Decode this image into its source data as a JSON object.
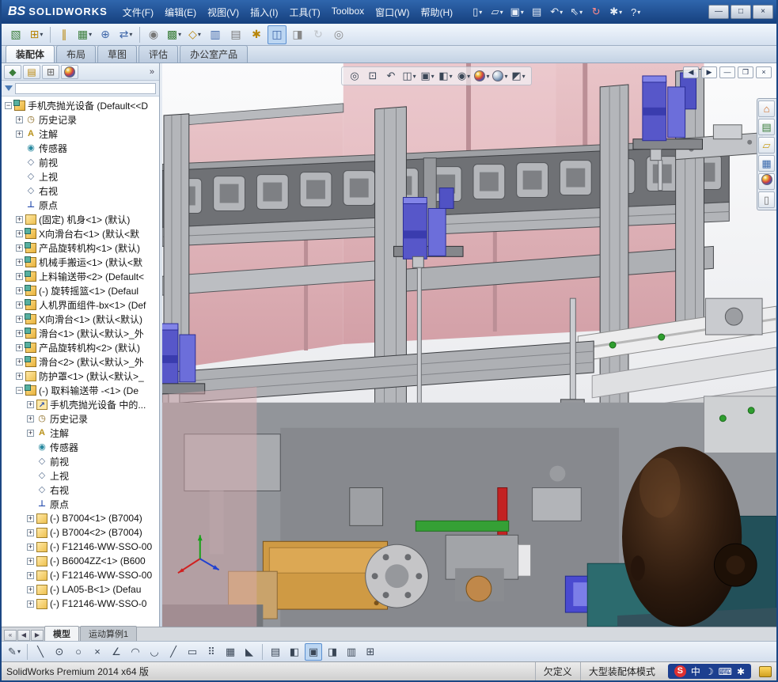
{
  "palette": {
    "titlebar-blue-1": "#2f66ad",
    "titlebar-blue-2": "#16407e",
    "toolbar-bg-1": "#f2f7fd",
    "toolbar-bg-2": "#d4e0ef",
    "panel-bg": "#e9eef6",
    "tree-bg": "#ffffff",
    "pink-panel": "#dcaab0",
    "pink-panel-light": "#e9c2c6",
    "frame-gray": "#b9bbbf",
    "frame-dark": "#4a4a4a",
    "chain-gray": "#9fa1a5",
    "cylinder-purple": "#5757c9",
    "cylinder-purple-dark": "#34349e",
    "gripper-pink": "#e2a2ac",
    "head-brown": "#3a2315",
    "head-dark": "#140b05",
    "orange-part": "#cf9a44",
    "red-part": "#c32222",
    "green-part": "#35a035",
    "teal-frame": "#2c6b6e",
    "blue-clamp": "#4a4ad0",
    "status-bg-1": "#ececec",
    "status-bg-2": "#cfcfcf",
    "ime-blue": "#1d3f8f",
    "sogou-red": "#e03030",
    "active-tool-bg": "#bcd6f2",
    "active-tool-border": "#5a8fd0"
  },
  "titlebar": {
    "logo_mark": "ΒS",
    "logo_text": "SOLIDWORKS",
    "menus": [
      "文件(F)",
      "编辑(E)",
      "视图(V)",
      "插入(I)",
      "工具(T)",
      "Toolbox",
      "窗口(W)",
      "帮助(H)"
    ],
    "quick_icons": [
      {
        "name": "new-document",
        "glyph": "▯",
        "dropdown": true
      },
      {
        "name": "open-document",
        "glyph": "▱",
        "dropdown": true
      },
      {
        "name": "save-document",
        "glyph": "▣",
        "dropdown": true
      },
      {
        "name": "print-document",
        "glyph": "▤"
      },
      {
        "name": "undo",
        "glyph": "↶",
        "dropdown": true
      },
      {
        "name": "select",
        "glyph": "⇖",
        "dropdown": true
      },
      {
        "name": "rebuild",
        "glyph": "↻",
        "color": "#ff8a8a"
      },
      {
        "name": "options",
        "glyph": "✱",
        "dropdown": true
      },
      {
        "name": "help",
        "glyph": "?",
        "dropdown": true
      }
    ],
    "window_buttons": [
      {
        "name": "minimize",
        "glyph": "—"
      },
      {
        "name": "maximize",
        "glyph": "□"
      },
      {
        "name": "close",
        "glyph": "×"
      }
    ]
  },
  "toolbar": {
    "icons": [
      {
        "name": "edit-component",
        "glyph": "▧",
        "color": "#3a7d3a"
      },
      {
        "name": "insert-components",
        "glyph": "⊞",
        "color": "#b8860b",
        "dropdown": true
      },
      {
        "sep": true
      },
      {
        "name": "mate",
        "glyph": "∥",
        "color": "#b8860b"
      },
      {
        "name": "component-pattern",
        "glyph": "▦",
        "color": "#3a7d3a",
        "dropdown": true
      },
      {
        "name": "smart-fasteners",
        "glyph": "⊕",
        "color": "#4169aa"
      },
      {
        "name": "move-component",
        "glyph": "⇄",
        "color": "#4169aa",
        "dropdown": true
      },
      {
        "sep": true
      },
      {
        "name": "show-hidden-components",
        "glyph": "◉",
        "color": "#777777"
      },
      {
        "name": "assembly-features",
        "glyph": "▩",
        "color": "#3a7d3a",
        "dropdown": true
      },
      {
        "name": "reference-geometry",
        "glyph": "◇",
        "color": "#b8860b",
        "dropdown": true
      },
      {
        "name": "new-motion-study",
        "glyph": "▥",
        "color": "#4169aa"
      },
      {
        "name": "bill-of-materials",
        "glyph": "▤",
        "color": "#777777"
      },
      {
        "name": "exploded-view",
        "glyph": "✱",
        "color": "#b8860b"
      },
      {
        "name": "instant3d",
        "glyph": "◫",
        "color": "#4169aa",
        "active": true
      },
      {
        "name": "section-view",
        "glyph": "◨",
        "color": "#888888"
      },
      {
        "name": "simulation",
        "glyph": "↻",
        "color": "#888888",
        "disabled": true
      },
      {
        "name": "isolate",
        "glyph": "◎",
        "color": "#888888"
      }
    ]
  },
  "command_tabs": {
    "items": [
      "装配体",
      "布局",
      "草图",
      "评估",
      "办公室产品"
    ],
    "active_index": 0
  },
  "panel": {
    "tab_icons": [
      {
        "name": "featuremanager-tab",
        "glyph": "◆",
        "color": "#3a7d3a"
      },
      {
        "name": "propertymanager-tab",
        "glyph": "▤",
        "color": "#b8860b"
      },
      {
        "name": "configurationmanager-tab",
        "glyph": "⊞",
        "color": "#777777"
      },
      {
        "name": "displaymanager-tab",
        "glyph": "sphere"
      }
    ],
    "overflow": "»",
    "filter_value": ""
  },
  "tree": {
    "rows": [
      {
        "label": "手机壳抛光设备 (Default<<D",
        "icon": "assembly",
        "level": 0,
        "expand": "minus"
      },
      {
        "label": "历史记录",
        "icon": "history",
        "level": 1,
        "expand": "plus"
      },
      {
        "label": "注解",
        "icon": "annotations",
        "level": 1,
        "expand": "plus"
      },
      {
        "label": "传感器",
        "icon": "sensors",
        "level": 1,
        "expand": null
      },
      {
        "label": "前视",
        "icon": "plane",
        "level": 1,
        "expand": null
      },
      {
        "label": "上视",
        "icon": "plane",
        "level": 1,
        "expand": null
      },
      {
        "label": "右视",
        "icon": "plane",
        "level": 1,
        "expand": null
      },
      {
        "label": "原点",
        "icon": "origin",
        "level": 1,
        "expand": null
      },
      {
        "label": "(固定) 机身<1> (默认)",
        "icon": "part",
        "level": 1,
        "expand": "plus"
      },
      {
        "label": "X向滑台右<1> (默认<默",
        "icon": "assembly",
        "level": 1,
        "expand": "plus"
      },
      {
        "label": "产品旋转机构<1> (默认)",
        "icon": "assembly",
        "level": 1,
        "expand": "plus"
      },
      {
        "label": "机械手搬运<1> (默认<默",
        "icon": "assembly",
        "level": 1,
        "expand": "plus"
      },
      {
        "label": "上料输送带<2> (Default<",
        "icon": "assembly",
        "level": 1,
        "expand": "plus"
      },
      {
        "label": "(-) 旋转摇篮<1> (Defaul",
        "icon": "assembly",
        "level": 1,
        "expand": "plus"
      },
      {
        "label": "人机界面组件-bx<1> (Def",
        "icon": "assembly",
        "level": 1,
        "expand": "plus"
      },
      {
        "label": "X向滑台<1> (默认<默认)",
        "icon": "assembly",
        "level": 1,
        "expand": "plus"
      },
      {
        "label": "滑台<1> (默认<默认>_外",
        "icon": "assembly",
        "level": 1,
        "expand": "plus"
      },
      {
        "label": "产品旋转机构<2> (默认)",
        "icon": "assembly",
        "level": 1,
        "expand": "plus"
      },
      {
        "label": "滑台<2> (默认<默认>_外",
        "icon": "assembly",
        "level": 1,
        "expand": "plus"
      },
      {
        "label": "防护罩<1> (默认<默认>_",
        "icon": "part",
        "level": 1,
        "expand": "plus"
      },
      {
        "label": "(-) 取料输送带 -<1> (De",
        "icon": "assembly",
        "level": 1,
        "expand": "minus"
      },
      {
        "label": "手机壳抛光设备 中的...",
        "icon": "incontext",
        "level": 2,
        "expand": "plus"
      },
      {
        "label": "历史记录",
        "icon": "history",
        "level": 2,
        "expand": "plus"
      },
      {
        "label": "注解",
        "icon": "annotations",
        "level": 2,
        "expand": "plus"
      },
      {
        "label": "传感器",
        "icon": "sensors",
        "level": 2,
        "expand": null
      },
      {
        "label": "前视",
        "icon": "plane",
        "level": 2,
        "expand": null
      },
      {
        "label": "上视",
        "icon": "plane",
        "level": 2,
        "expand": null
      },
      {
        "label": "右视",
        "icon": "plane",
        "level": 2,
        "expand": null
      },
      {
        "label": "原点",
        "icon": "origin",
        "level": 2,
        "expand": null
      },
      {
        "label": "(-) B7004<1> (B7004)",
        "icon": "part",
        "level": 2,
        "expand": "plus"
      },
      {
        "label": "(-) B7004<2> (B7004)",
        "icon": "part",
        "level": 2,
        "expand": "plus"
      },
      {
        "label": "(-) F12146-WW-SSO-00",
        "icon": "part",
        "level": 2,
        "expand": "plus"
      },
      {
        "label": "(-) B6004ZZ<1> (B600",
        "icon": "part",
        "level": 2,
        "expand": "plus"
      },
      {
        "label": "(-) F12146-WW-SSO-00",
        "icon": "part",
        "level": 2,
        "expand": "plus"
      },
      {
        "label": "(-) LA05-B<1> (Defau",
        "icon": "part",
        "level": 2,
        "expand": "plus"
      },
      {
        "label": "(-) F12146-WW-SSO-0",
        "icon": "part",
        "level": 2,
        "expand": "plus"
      }
    ]
  },
  "viewport": {
    "hud_icons": [
      {
        "name": "zoom-fit",
        "glyph": "◎"
      },
      {
        "name": "zoom-area",
        "glyph": "⊡"
      },
      {
        "name": "previous-view",
        "glyph": "↶"
      },
      {
        "name": "section-view",
        "glyph": "◫",
        "dropdown": true
      },
      {
        "name": "view-orientation",
        "glyph": "▣",
        "dropdown": true
      },
      {
        "name": "display-style",
        "glyph": "◧",
        "dropdown": true
      },
      {
        "name": "hide-show-items",
        "glyph": "◉",
        "dropdown": true
      },
      {
        "name": "edit-appearance",
        "glyph": "sphere",
        "dropdown": true
      },
      {
        "name": "apply-scene",
        "glyph": "sphere2",
        "dropdown": true
      },
      {
        "name": "view-settings",
        "glyph": "◩",
        "dropdown": true
      }
    ],
    "window_controls": [
      {
        "name": "previous-window",
        "glyph": "◀"
      },
      {
        "name": "next-window",
        "glyph": "▶"
      },
      {
        "name": "minimize-document",
        "glyph": "—"
      },
      {
        "name": "restore-document",
        "glyph": "❐"
      },
      {
        "name": "close-document",
        "glyph": "×"
      }
    ],
    "taskpane_icons": [
      {
        "name": "home",
        "glyph": "⌂",
        "color": "#d06820"
      },
      {
        "name": "design-library",
        "glyph": "▤",
        "color": "#3a7d3a"
      },
      {
        "name": "file-explorer",
        "glyph": "▱",
        "color": "#c8a020"
      },
      {
        "name": "view-palette",
        "glyph": "▦",
        "color": "#3a6aad"
      },
      {
        "name": "appearances",
        "glyph": "sphere"
      },
      {
        "name": "custom-properties",
        "glyph": "▯",
        "color": "#777777"
      }
    ]
  },
  "bottom": {
    "nav": [
      {
        "name": "tab-scroll-first",
        "glyph": "«"
      },
      {
        "name": "tab-scroll-prev",
        "glyph": "◀"
      },
      {
        "name": "tab-scroll-next",
        "glyph": "▶"
      }
    ],
    "tabs": [
      "模型",
      "运动算例1"
    ],
    "active_index": 0,
    "tools": [
      {
        "name": "sketch-flyout",
        "glyph": "✎",
        "dropdown": true
      },
      {
        "sep": true
      },
      {
        "name": "line-tool",
        "glyph": "╲"
      },
      {
        "name": "circle-tool",
        "glyph": "⊙"
      },
      {
        "name": "ellipse-tool",
        "glyph": "○"
      },
      {
        "name": "trim-tool",
        "glyph": "×"
      },
      {
        "name": "angle-dimension-tool",
        "glyph": "∠"
      },
      {
        "name": "arc-tool",
        "glyph": "◠"
      },
      {
        "name": "tangent-arc-tool",
        "glyph": "◡"
      },
      {
        "name": "spline-tool",
        "glyph": "╱"
      },
      {
        "name": "rectangle-tool",
        "glyph": "▭"
      },
      {
        "name": "point-tool",
        "glyph": "⠿"
      },
      {
        "name": "pattern-tool",
        "glyph": "▦"
      },
      {
        "name": "chamfer-tool",
        "glyph": "◣"
      },
      {
        "sep": true
      },
      {
        "name": "standard-views",
        "glyph": "▤"
      },
      {
        "name": "wireframe-view",
        "glyph": "◧"
      },
      {
        "name": "shaded-view",
        "glyph": "▣",
        "active": true
      },
      {
        "name": "section-display",
        "glyph": "◨"
      },
      {
        "name": "perspective-view",
        "glyph": "▥"
      },
      {
        "name": "grid-settings",
        "glyph": "⊞"
      }
    ]
  },
  "statusbar": {
    "left": "SolidWorks Premium 2014 x64 版",
    "state": "欠定义",
    "mode": "大型装配体模式",
    "ime": {
      "logo": "S",
      "icons": [
        {
          "name": "ime-lang-mode",
          "glyph": "中"
        },
        {
          "name": "ime-fullwidth-mode",
          "glyph": "☽"
        },
        {
          "name": "ime-soft-keyboard",
          "glyph": "⌨"
        },
        {
          "name": "ime-toolbox",
          "glyph": "✱"
        }
      ]
    }
  }
}
